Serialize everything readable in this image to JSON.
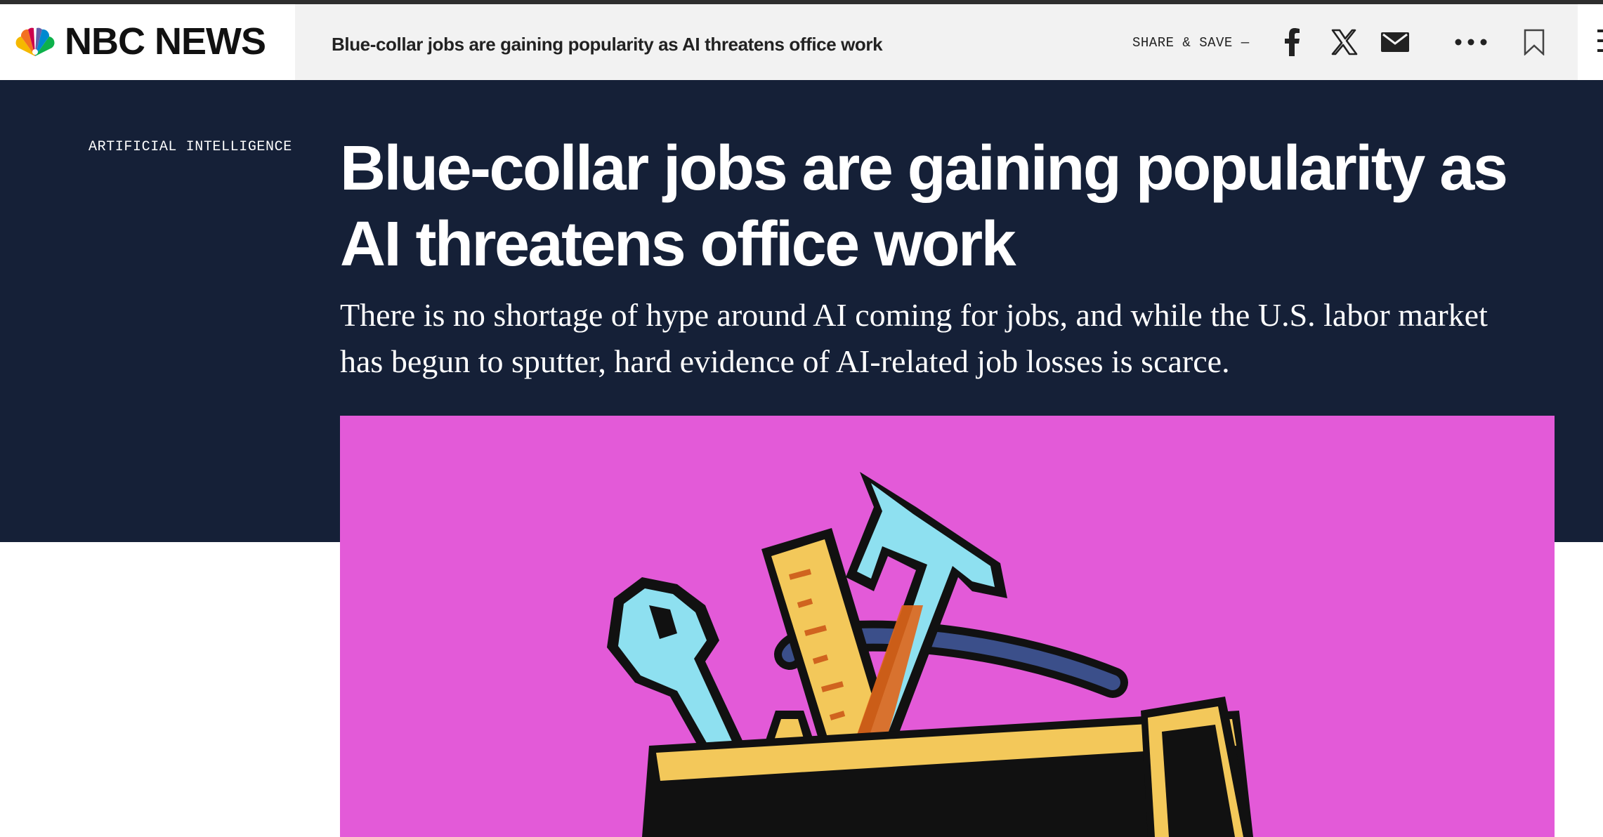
{
  "header": {
    "brand": "NBC NEWS",
    "article_title": "Blue-collar jobs are gaining popularity as AI threatens office work",
    "share_label": "SHARE & SAVE —",
    "icons": [
      "facebook-icon",
      "x-icon",
      "email-icon",
      "more-icon",
      "bookmark-icon",
      "menu-icon"
    ]
  },
  "article": {
    "section": "ARTIFICIAL INTELLIGENCE",
    "headline": "Blue-collar jobs are gaining popularity as AI threatens office work",
    "dek": "There is no shortage of hype around AI coming for jobs, and while the U.S. labor market has begun to sputter, hard evidence of AI-related job losses is scarce."
  },
  "hero_image": {
    "background_color": "#e35ad8",
    "content": "pixel-art toolbox with wrench, ruler, pencil and hammer"
  },
  "colors": {
    "hero_bg": "#152037",
    "header_bg": "#f2f2f2",
    "peacock": [
      "#f5b800",
      "#f37021",
      "#cc004c",
      "#6460aa",
      "#0089d0",
      "#0db14b"
    ]
  }
}
